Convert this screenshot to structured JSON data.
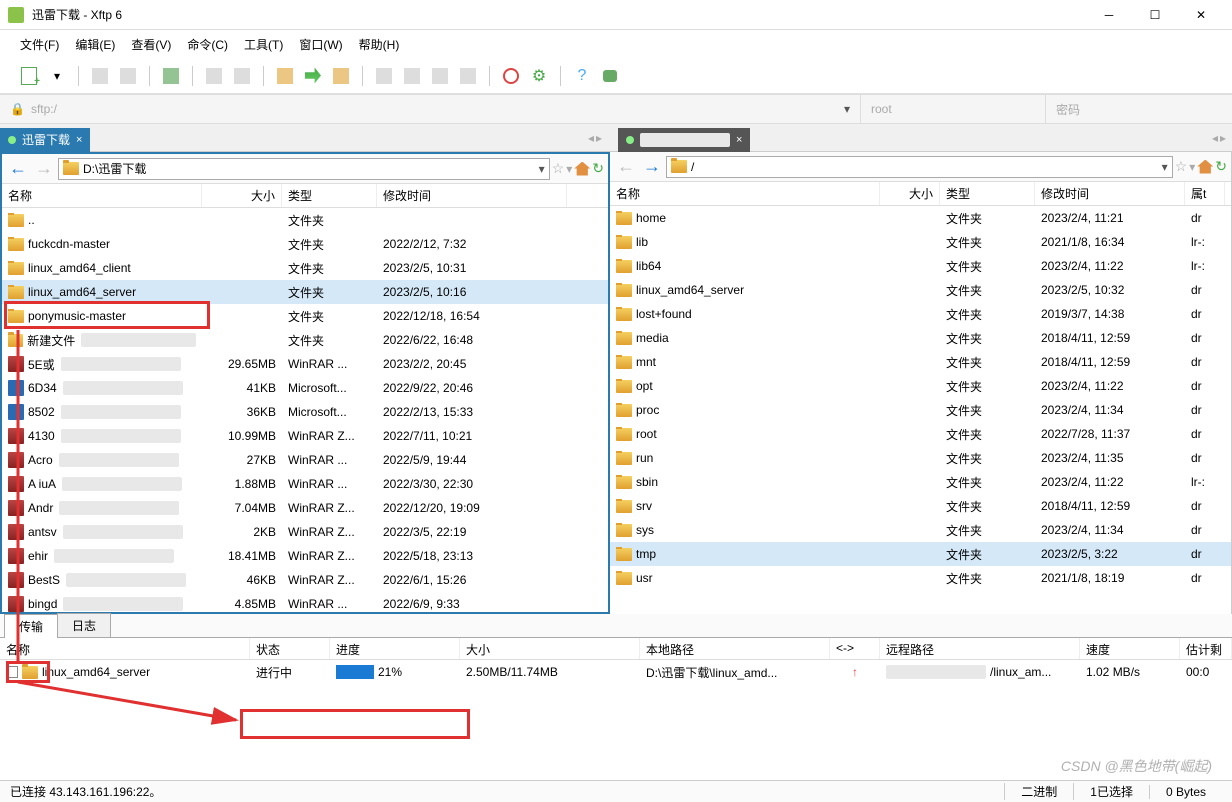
{
  "window": {
    "title": "迅雷下载 - Xftp 6"
  },
  "menu": {
    "file": "文件(F)",
    "edit": "编辑(E)",
    "view": "查看(V)",
    "cmd": "命令(C)",
    "tool": "工具(T)",
    "win": "窗口(W)",
    "help": "帮助(H)"
  },
  "address": {
    "prefix": "sftp:/",
    "user": "root",
    "pass": "密码"
  },
  "tabs": {
    "local": "迅雷下载",
    "remote": "        "
  },
  "paths": {
    "local": "D:\\迅雷下载",
    "remote": "/"
  },
  "headers": {
    "name": "名称",
    "size": "大小",
    "type": "类型",
    "date": "修改时间",
    "attr": "属t"
  },
  "local_files": [
    {
      "icon": "folder",
      "name": "..",
      "size": "",
      "type": "文件夹",
      "date": ""
    },
    {
      "icon": "folder",
      "name": "fuckcdn-master",
      "size": "",
      "type": "文件夹",
      "date": "2022/2/12, 7:32"
    },
    {
      "icon": "folder",
      "name": "linux_amd64_client",
      "size": "",
      "type": "文件夹",
      "date": "2023/2/5, 10:31"
    },
    {
      "icon": "folder",
      "name": "linux_amd64_server",
      "size": "",
      "type": "文件夹",
      "date": "2023/2/5, 10:16",
      "selected": true
    },
    {
      "icon": "folder",
      "name": "ponymusic-master",
      "size": "",
      "type": "文件夹",
      "date": "2022/12/18, 16:54"
    },
    {
      "icon": "folder",
      "name": "新建文件",
      "size": "",
      "type": "文件夹",
      "date": "2022/6/22, 16:48"
    },
    {
      "icon": "rar",
      "name": "5E或",
      "size": "29.65MB",
      "type": "WinRAR ...",
      "date": "2023/2/2, 20:45"
    },
    {
      "icon": "doc",
      "name": "6D34",
      "size": "41KB",
      "type": "Microsoft...",
      "date": "2022/9/22, 20:46"
    },
    {
      "icon": "doc",
      "name": "8502",
      "size": "36KB",
      "type": "Microsoft...",
      "date": "2022/2/13, 15:33"
    },
    {
      "icon": "rar",
      "name": "4130",
      "size": "10.99MB",
      "type": "WinRAR Z...",
      "date": "2022/7/11, 10:21"
    },
    {
      "icon": "rar",
      "name": "Acro",
      "size": "27KB",
      "type": "WinRAR ...",
      "date": "2022/5/9, 19:44"
    },
    {
      "icon": "rar",
      "name": "A iuA",
      "size": "1.88MB",
      "type": "WinRAR ...",
      "date": "2022/3/30, 22:30"
    },
    {
      "icon": "rar",
      "name": "Andr",
      "size": "7.04MB",
      "type": "WinRAR Z...",
      "date": "2022/12/20, 19:09"
    },
    {
      "icon": "rar",
      "name": "antsv",
      "size": "2KB",
      "type": "WinRAR Z...",
      "date": "2022/3/5, 22:19"
    },
    {
      "icon": "rar",
      "name": "ehir",
      "size": "18.41MB",
      "type": "WinRAR Z...",
      "date": "2022/5/18, 23:13"
    },
    {
      "icon": "rar",
      "name": "BestS",
      "size": "46KB",
      "type": "WinRAR Z...",
      "date": "2022/6/1, 15:26"
    },
    {
      "icon": "rar",
      "name": "bingd",
      "size": "4.85MB",
      "type": "WinRAR ...",
      "date": "2022/6/9, 9:33"
    }
  ],
  "remote_files": [
    {
      "icon": "folder",
      "name": "home",
      "size": "",
      "type": "文件夹",
      "date": "2023/2/4, 11:21",
      "attr": "dr"
    },
    {
      "icon": "folder",
      "name": "lib",
      "size": "",
      "type": "文件夹",
      "date": "2021/1/8, 16:34",
      "attr": "lr-:"
    },
    {
      "icon": "folder",
      "name": "lib64",
      "size": "",
      "type": "文件夹",
      "date": "2023/2/4, 11:22",
      "attr": "lr-:"
    },
    {
      "icon": "folder",
      "name": "linux_amd64_server",
      "size": "",
      "type": "文件夹",
      "date": "2023/2/5, 10:32",
      "attr": "dr"
    },
    {
      "icon": "folder",
      "name": "lost+found",
      "size": "",
      "type": "文件夹",
      "date": "2019/3/7, 14:38",
      "attr": "dr"
    },
    {
      "icon": "folder",
      "name": "media",
      "size": "",
      "type": "文件夹",
      "date": "2018/4/11, 12:59",
      "attr": "dr"
    },
    {
      "icon": "folder",
      "name": "mnt",
      "size": "",
      "type": "文件夹",
      "date": "2018/4/11, 12:59",
      "attr": "dr"
    },
    {
      "icon": "folder",
      "name": "opt",
      "size": "",
      "type": "文件夹",
      "date": "2023/2/4, 11:22",
      "attr": "dr"
    },
    {
      "icon": "folder",
      "name": "proc",
      "size": "",
      "type": "文件夹",
      "date": "2023/2/4, 11:34",
      "attr": "dr"
    },
    {
      "icon": "folder",
      "name": "root",
      "size": "",
      "type": "文件夹",
      "date": "2022/7/28, 11:37",
      "attr": "dr"
    },
    {
      "icon": "folder",
      "name": "run",
      "size": "",
      "type": "文件夹",
      "date": "2023/2/4, 11:35",
      "attr": "dr"
    },
    {
      "icon": "folder",
      "name": "sbin",
      "size": "",
      "type": "文件夹",
      "date": "2023/2/4, 11:22",
      "attr": "lr-:"
    },
    {
      "icon": "folder",
      "name": "srv",
      "size": "",
      "type": "文件夹",
      "date": "2018/4/11, 12:59",
      "attr": "dr"
    },
    {
      "icon": "folder",
      "name": "sys",
      "size": "",
      "type": "文件夹",
      "date": "2023/2/4, 11:34",
      "attr": "dr"
    },
    {
      "icon": "folder",
      "name": "tmp",
      "size": "",
      "type": "文件夹",
      "date": "2023/2/5, 3:22",
      "attr": "dr",
      "hl": true
    },
    {
      "icon": "folder",
      "name": "usr",
      "size": "",
      "type": "文件夹",
      "date": "2021/1/8, 18:19",
      "attr": "dr"
    }
  ],
  "bottom_tabs": {
    "transfer": "传输",
    "log": "日志"
  },
  "transfer": {
    "headers": {
      "name": "名称",
      "status": "状态",
      "progress": "进度",
      "size": "大小",
      "local": "本地路径",
      "arrow": "<->",
      "remote": "远程路径",
      "speed": "速度",
      "est": "估计剩"
    },
    "row": {
      "name": "linux_amd64_server",
      "status": "进行中",
      "progress": "21%",
      "size": "2.50MB/11.74MB",
      "local": "D:\\迅雷下载\\linux_amd...",
      "remote": "/linux_am...",
      "speed": "1.02 MB/s",
      "est": "00:0"
    }
  },
  "status": {
    "conn": "已连接 43.143.161.196:22。",
    "binary": "二进制",
    "selected": "1已选择",
    "bytes": "0 Bytes"
  },
  "watermark": "CSDN @黑色地带(崛起)"
}
